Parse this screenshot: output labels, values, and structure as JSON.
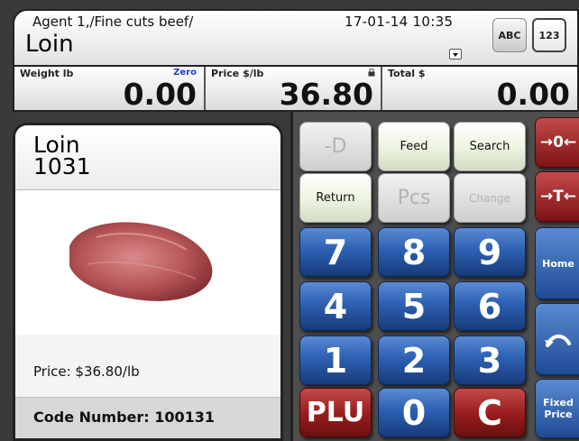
{
  "header": {
    "breadcrumb": "Agent 1,/Fine cuts beef/",
    "product": "Loin",
    "datetime": "17-01-14 10:35",
    "abc_label": "ABC",
    "num_label": "123"
  },
  "readouts": {
    "weight_label": "Weight lb",
    "zero_flag": "Zero",
    "weight_value": "0.00",
    "price_label": "Price $/lb",
    "price_value": "36.80",
    "total_label": "Total $",
    "total_value": "0.00"
  },
  "product_panel": {
    "name": "Loin",
    "plu": "1031",
    "price_text": "Price: $36.80/lb",
    "code_text": "Code Number: 100131"
  },
  "keys": {
    "minus_d": "-D",
    "feed": "Feed",
    "search": "Search",
    "return": "Return",
    "pcs": "Pcs",
    "change": "Change",
    "k7": "7",
    "k8": "8",
    "k9": "9",
    "k4": "4",
    "k5": "5",
    "k6": "6",
    "k1": "1",
    "k2": "2",
    "k3": "3",
    "plu": "PLU",
    "k0": "0",
    "clear": "C"
  },
  "side_keys": {
    "zero": "→0←",
    "tare": "→T←",
    "home": "Home",
    "back_icon": "back-arrow-icon",
    "fixed_price": "Fixed Price"
  },
  "colors": {
    "key_blue": "#2d60b3",
    "key_red": "#9a1e1e",
    "zero_flag": "#1a3fd6"
  }
}
